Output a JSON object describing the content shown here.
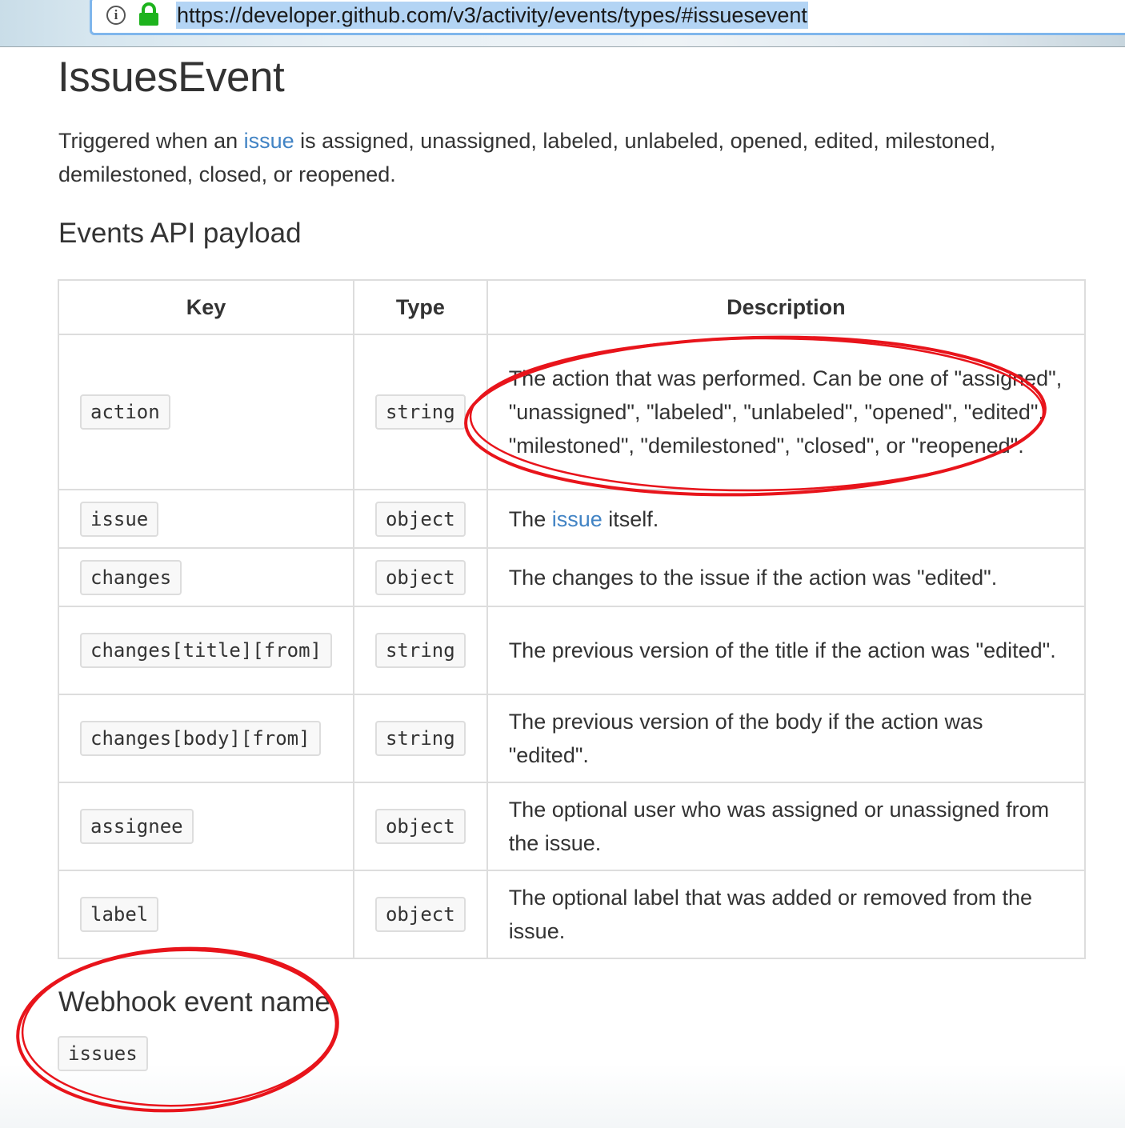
{
  "browser": {
    "url": "https://developer.github.com/v3/activity/events/types/#issuesevent",
    "info_icon_glyph": "i",
    "icons": [
      "info-icon",
      "lock-icon"
    ],
    "lock_color": "#1db31d"
  },
  "page": {
    "title": "IssuesEvent",
    "intro_before": "Triggered when an ",
    "intro_link": "issue",
    "intro_after": " is assigned, unassigned, labeled, unlabeled, opened, edited, milestoned, demilestoned, closed, or reopened.",
    "payload_heading": "Events API payload",
    "link_color": "#4183c4"
  },
  "table": {
    "headers": {
      "key": "Key",
      "type": "Type",
      "description": "Description"
    },
    "rows": [
      {
        "key": "action",
        "type": "string",
        "description": "The action that was performed. Can be one of \"assigned\", \"unassigned\", \"labeled\", \"unlabeled\", \"opened\", \"edited\", \"milestoned\", \"demilestoned\", \"closed\", or \"reopened\"."
      },
      {
        "key": "issue",
        "type": "object",
        "desc_before": "The ",
        "desc_link": "issue",
        "desc_after": " itself."
      },
      {
        "key": "changes",
        "type": "object",
        "description": "The changes to the issue if the action was \"edited\"."
      },
      {
        "key": "changes[title][from]",
        "type": "string",
        "description": "The previous version of the title if the action was \"edited\"."
      },
      {
        "key": "changes[body][from]",
        "type": "string",
        "description": "The previous version of the body if the action was \"edited\"."
      },
      {
        "key": "assignee",
        "type": "object",
        "description": "The optional user who was assigned or unassigned from the issue."
      },
      {
        "key": "label",
        "type": "object",
        "description": "The optional label that was added or removed from the issue."
      }
    ]
  },
  "webhook": {
    "heading": "Webhook event name",
    "name": "issues"
  },
  "annotations": {
    "color": "#e8141b",
    "marks": [
      "annotation-circle-action-description",
      "annotation-circle-webhook"
    ]
  }
}
